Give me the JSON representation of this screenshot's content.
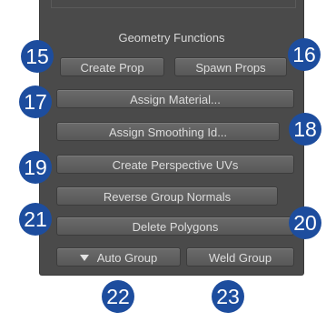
{
  "panel": {
    "title": "Geometry Functions"
  },
  "buttons": {
    "create_prop": "Create Prop",
    "spawn_props": "Spawn Props",
    "assign_material": "Assign Material...",
    "assign_smoothing_id": "Assign Smoothing Id...",
    "create_perspective_uvs": "Create Perspective UVs",
    "reverse_group_normals": "Reverse Group Normals",
    "delete_polygons": "Delete Polygons",
    "auto_group": "Auto Group",
    "weld_group": "Weld Group"
  },
  "badges": {
    "b15": "15",
    "b16": "16",
    "b17": "17",
    "b18": "18",
    "b19": "19",
    "b20": "20",
    "b21": "21",
    "b22": "22",
    "b23": "23"
  },
  "icons": {
    "auto_group": "triangle-down-icon"
  },
  "colors": {
    "panel_background": "#4a4a4a",
    "button_background": "#5f5f5f",
    "button_text": "#dcdcdc",
    "badge_background": "#1d4d9e",
    "badge_text": "#ffffff"
  }
}
